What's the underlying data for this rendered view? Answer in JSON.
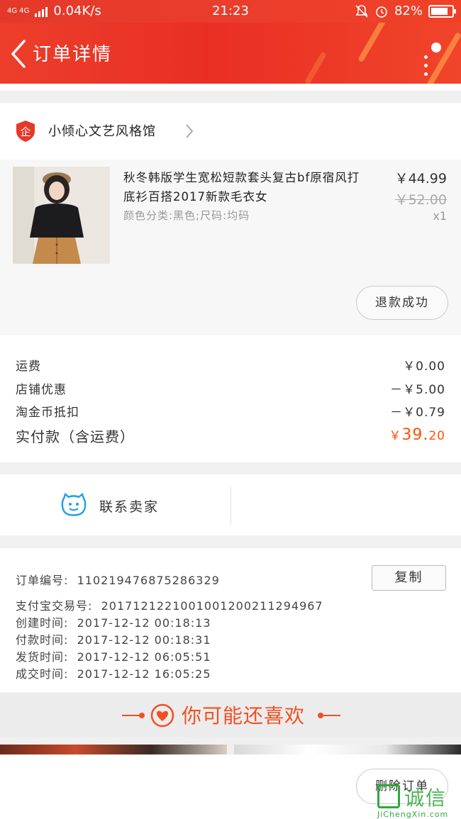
{
  "status_bar": {
    "signal": "4G 4G",
    "speed": "0.04K/s",
    "time": "21:23",
    "battery": "82%",
    "battery_level": 0.82
  },
  "header": {
    "title": "订单详情",
    "back_icon": "chevron-left-icon",
    "more_icon": "more-dots-icon"
  },
  "shop": {
    "badge_text": "企",
    "name": "小倾心文艺风格馆"
  },
  "item": {
    "name": "秋冬韩版学生宽松短款套头复古bf原宿风打底衫百搭2017新款毛衣女",
    "spec": "颜色分类:黑色;尺码:均码",
    "price": "￥44.99",
    "original_price": "￥52.00",
    "quantity": "x1",
    "refund_status": "退款成功"
  },
  "costs": {
    "shipping_label": "运费",
    "shipping_value": "￥0.00",
    "shop_discount_label": "店铺优惠",
    "shop_discount_value": "－￥5.00",
    "coins_label": "淘金币抵扣",
    "coins_value": "－￥0.79",
    "total_label": "实付款（含运费）",
    "total_symbol": "￥",
    "total_main": "39.",
    "total_cents": "20"
  },
  "contact": {
    "label": "联系卖家"
  },
  "order_info": {
    "order_no_label": "订单编号:",
    "order_no": "110219476875286329",
    "copy_button": "复制",
    "alipay_label": "支付宝交易号:",
    "alipay_no": "2017121221001001200211294967",
    "created_label": "创建时间:",
    "created": "2017-12-12 00:18:13",
    "paid_label": "付款时间:",
    "paid": "2017-12-12 00:18:31",
    "shipped_label": "发货时间:",
    "shipped": "2017-12-12 06:05:51",
    "closed_label": "成交时间:",
    "closed": "2017-12-12 16:05:25"
  },
  "recommend": {
    "title": "你可能还喜欢"
  },
  "bottom": {
    "delete_button": "删除订单"
  },
  "watermark": {
    "text": "诚信",
    "url": "JiChengXin.com"
  },
  "colors": {
    "brand_red": "#e92f24",
    "price_orange": "#ff5000",
    "watermark_green": "#2fa83a"
  }
}
